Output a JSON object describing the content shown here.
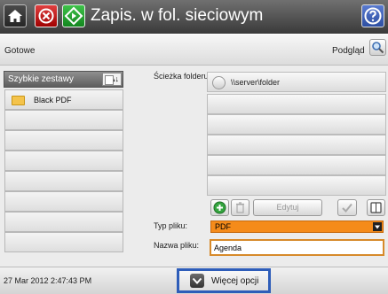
{
  "header": {
    "title": "Zapis. w fol. sieciowym"
  },
  "status_bar": {
    "status": "Gotowe",
    "preview_label": "Podgląd"
  },
  "quick_sets": {
    "header_label": "Szybkie zestawy",
    "sort_label": "A↓",
    "items": [
      "Black PDF"
    ]
  },
  "folder": {
    "label": "Ścieżka folderu:",
    "paths": [
      "\\\\server\\folder"
    ],
    "edit_label": "Edytuj"
  },
  "file_type": {
    "label": "Typ pliku:",
    "value": "PDF"
  },
  "file_name": {
    "label": "Nazwa pliku:",
    "value": "Agenda"
  },
  "footer": {
    "datetime": "27 Mar 2012 2:47:43 PM",
    "more_options_label": "Więcej opcji"
  },
  "colors": {
    "titlebar": "#4a4a4a",
    "accent_orange": "#f58b1a",
    "focus_blue": "#2e5db9"
  }
}
